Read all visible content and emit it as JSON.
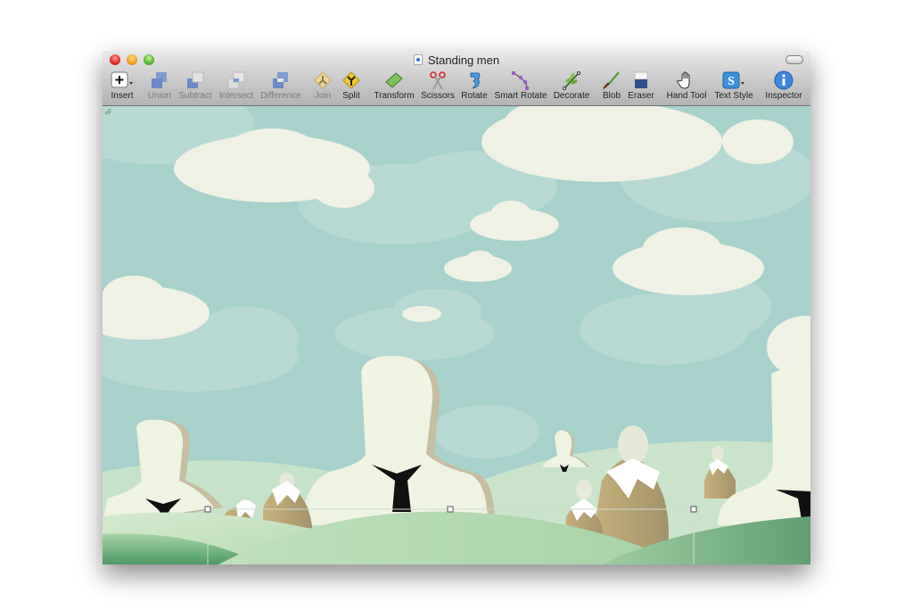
{
  "window": {
    "title": "Standing men",
    "traffic_lights": [
      "close",
      "minimize",
      "zoom"
    ]
  },
  "toolbar": {
    "items": [
      {
        "label": "Insert",
        "icon": "plus-icon",
        "enabled": true,
        "has_menu": true
      },
      {
        "label": "Union",
        "icon": "union-icon",
        "enabled": false
      },
      {
        "label": "Subtract",
        "icon": "subtract-icon",
        "enabled": false
      },
      {
        "label": "Intersect",
        "icon": "intersect-icon",
        "enabled": false
      },
      {
        "label": "Difference",
        "icon": "difference-icon",
        "enabled": false
      },
      {
        "label": "Join",
        "icon": "join-icon",
        "enabled": false
      },
      {
        "label": "Split",
        "icon": "split-icon",
        "enabled": true
      },
      {
        "label": "Transform",
        "icon": "transform-icon",
        "enabled": true
      },
      {
        "label": "Scissors",
        "icon": "scissors-icon",
        "enabled": true
      },
      {
        "label": "Rotate",
        "icon": "rotate-icon",
        "enabled": true
      },
      {
        "label": "Smart Rotate",
        "icon": "smart-rotate-icon",
        "enabled": true
      },
      {
        "label": "Decorate",
        "icon": "decorate-icon",
        "enabled": true
      },
      {
        "label": "Blob",
        "icon": "brush-icon",
        "enabled": true
      },
      {
        "label": "Eraser",
        "icon": "eraser-icon",
        "enabled": true
      },
      {
        "label": "Hand Tool",
        "icon": "hand-icon",
        "enabled": true
      },
      {
        "label": "Text Style",
        "icon": "text-style-icon",
        "enabled": true,
        "has_menu": true
      },
      {
        "label": "Inspector",
        "icon": "info-icon",
        "enabled": true
      }
    ]
  },
  "canvas": {
    "scene": "Standing men illustration",
    "colors": {
      "sky": "#a7d2cb",
      "cloud": "#eef1e3",
      "cloud_back": "#bcdcd6",
      "figure": "#eff3e2",
      "figure_shadow": "#c5bea0",
      "tie": "#111111",
      "mountain": "#b09b6c",
      "hill_light": "#c3e2bd",
      "hill_mid": "#9fcc9c",
      "hill_dark": "#6fb07e"
    }
  }
}
